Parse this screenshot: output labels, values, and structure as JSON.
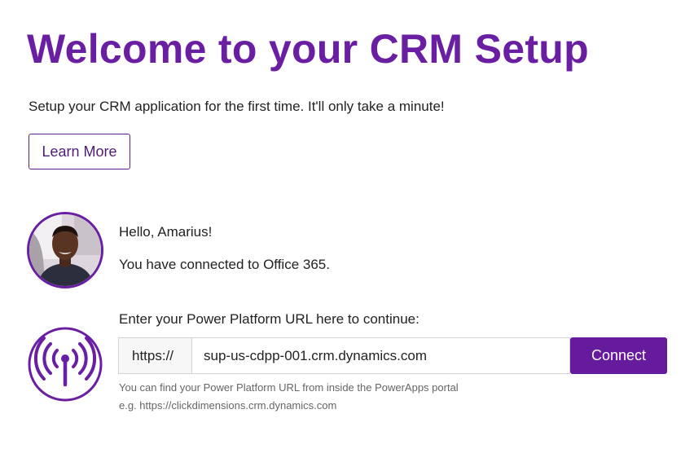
{
  "header": {
    "title": "Welcome to your CRM Setup",
    "subtitle": "Setup your CRM application for the first time. It'll only take a minute!",
    "learn_more_label": "Learn More"
  },
  "user": {
    "greeting": "Hello, Amarius!",
    "status": "You have connected to Office 365."
  },
  "url_form": {
    "label": "Enter your Power Platform URL here to continue:",
    "prefix": "https://",
    "value": "sup-us-cdpp-001.crm.dynamics.com",
    "connect_label": "Connect",
    "help_line_1": "You can find your Power Platform URL from inside the PowerApps portal",
    "help_line_2": "e.g. https://clickdimensions.crm.dynamics.com"
  },
  "icons": {
    "avatar": "user-photo",
    "signal": "broadcast-tower-icon"
  },
  "colors": {
    "accent": "#6a1fa3",
    "button": "#661a9c",
    "help_text": "#666666"
  }
}
